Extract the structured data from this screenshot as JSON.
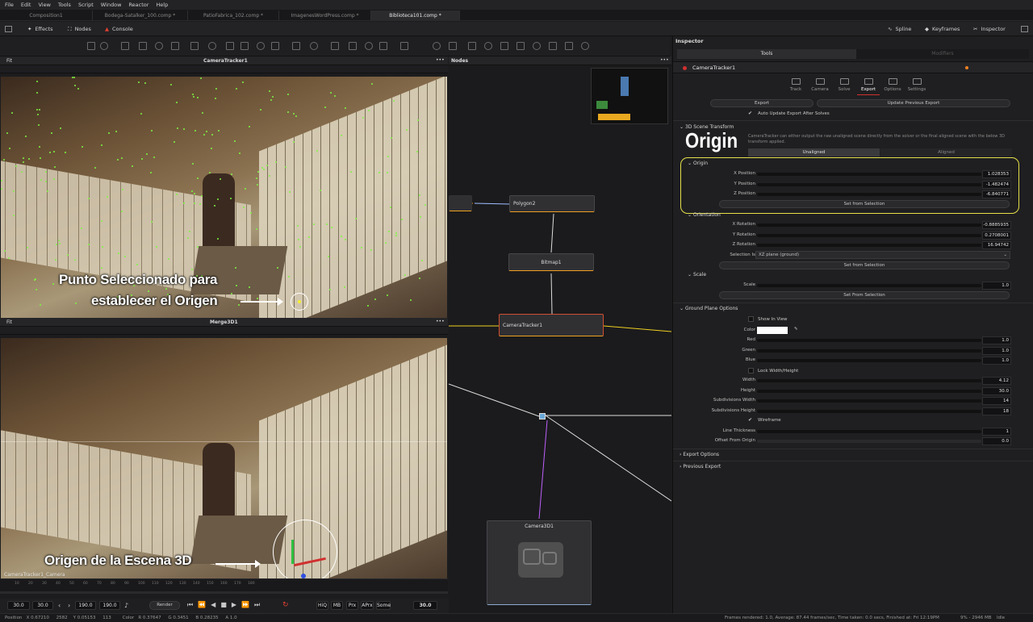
{
  "menu": [
    "File",
    "Edit",
    "View",
    "Tools",
    "Script",
    "Window",
    "Reactor",
    "Help"
  ],
  "tabs": [
    "Composition1",
    "Bodega-Satalker_100.comp *",
    "PatioFabrica_102.comp *",
    "ImagenesWordPress.comp *",
    "Biblioteca101.comp *"
  ],
  "toolbar": {
    "effects": "Effects",
    "nodes": "Nodes",
    "console": "Console",
    "spline": "Spline",
    "keyframes": "Keyframes",
    "inspector": "Inspector"
  },
  "viewer1": {
    "fit": "Fit",
    "title": "CameraTracker1"
  },
  "viewer2": {
    "fit": "Fit",
    "title": "Merge3D1",
    "corner_label": "CameraTracker1_Camera"
  },
  "annotations": {
    "punto_line1": "Punto Seleccionado para",
    "punto_line2": "establecer el Origen",
    "origen": "Origen de la Escena 3D",
    "origin_big": "Origin"
  },
  "ruler": [
    "10",
    "20",
    "30",
    "40",
    "50",
    "60",
    "70",
    "80",
    "90",
    "100",
    "110",
    "120",
    "130",
    "140",
    "150",
    "160",
    "170",
    "180"
  ],
  "transport": {
    "start": "30.0",
    "start2": "30.0",
    "end": "190.0",
    "end2": "190.0",
    "render": "Render",
    "hiq": "HiQ",
    "mb": "MB",
    "prx": "Prx",
    "aprx": "APrx",
    "some": "Some",
    "current": "30.0"
  },
  "nodes_panel": {
    "title": "Nodes",
    "polygon": "Polygon2",
    "bitmap": "Bitmap1",
    "tracker": "CameraTracker1",
    "camera": "Camera3D1"
  },
  "inspector": {
    "title": "Inspector",
    "tools_tab": "Tools",
    "modifiers_tab": "Modifiers",
    "tool_name": "CameraTracker1",
    "subtabs": [
      "Track",
      "Camera",
      "Solve",
      "Export",
      "Options",
      "Settings"
    ],
    "export_btn": "Export",
    "update_btn": "Update Previous Export",
    "auto_update": "Auto Update Export After Solves",
    "scene_transform": "3D Scene Transform",
    "description": "CameraTracker can either output the raw unaligned scene directly from the solver or the final aligned scene with the below 3D transform applied.",
    "unaligned": "Unaligned",
    "aligned": "Aligned",
    "origin": "Origin",
    "x_pos_label": "X Position",
    "x_pos": "1.028353",
    "y_pos_label": "Y Position",
    "y_pos": "-1.482474",
    "z_pos_label": "Z Position",
    "z_pos": "-6.840771",
    "set_from_selection": "Set from Selection",
    "orientation": "Orientation",
    "x_rot_label": "X Rotation",
    "x_rot": "-0.8885935",
    "y_rot_label": "Y Rotation",
    "y_rot": "0.2708001",
    "z_rot_label": "Z Rotation",
    "z_rot": "16.94742",
    "selection_is_label": "Selection Is",
    "selection_is": "XZ plane (ground)",
    "set_from_selection2": "Set from Selection",
    "scale_section": "Scale",
    "scale_label": "Scale",
    "scale": "1.0",
    "set_from_selection3": "Set From Selection",
    "ground_plane": "Ground Plane Options",
    "show_in_view": "Show In View",
    "color_label": "Color",
    "red_label": "Red",
    "red": "1.0",
    "green_label": "Green",
    "green": "1.0",
    "blue_label": "Blue",
    "blue": "1.0",
    "lock_wh": "Lock Width/Height",
    "width_label": "Width",
    "width": "4.12",
    "height_label": "Height",
    "height": "30.0",
    "subw_label": "Subdivisions Width",
    "subw": "14",
    "subh_label": "Subdivisions Height",
    "subh": "18",
    "wireframe": "Wireframe",
    "line_thickness_label": "Line Thickness",
    "line_thickness": "1",
    "offset_label": "Offset From Origin",
    "offset": "0.0",
    "export_options": "Export Options",
    "previous_export": "Previous Export"
  },
  "status": {
    "left": "Position   X 0.67210     2582    Y 0.05153     113        Color   R 0.37647     G 0.3451     B 0.28235     A 1.0",
    "right": "Frames rendered: 1.0,  Average: 87.44 frames/sec,  Time taken: 0.0 secs,  Finished at: Fri 12:19PM",
    "mem": "9% - 2946 MB",
    "state": "Idle"
  },
  "colors": {
    "accent_orange": "#f0a020",
    "highlight_yellow": "#e5e04a",
    "red": "#d03030"
  }
}
